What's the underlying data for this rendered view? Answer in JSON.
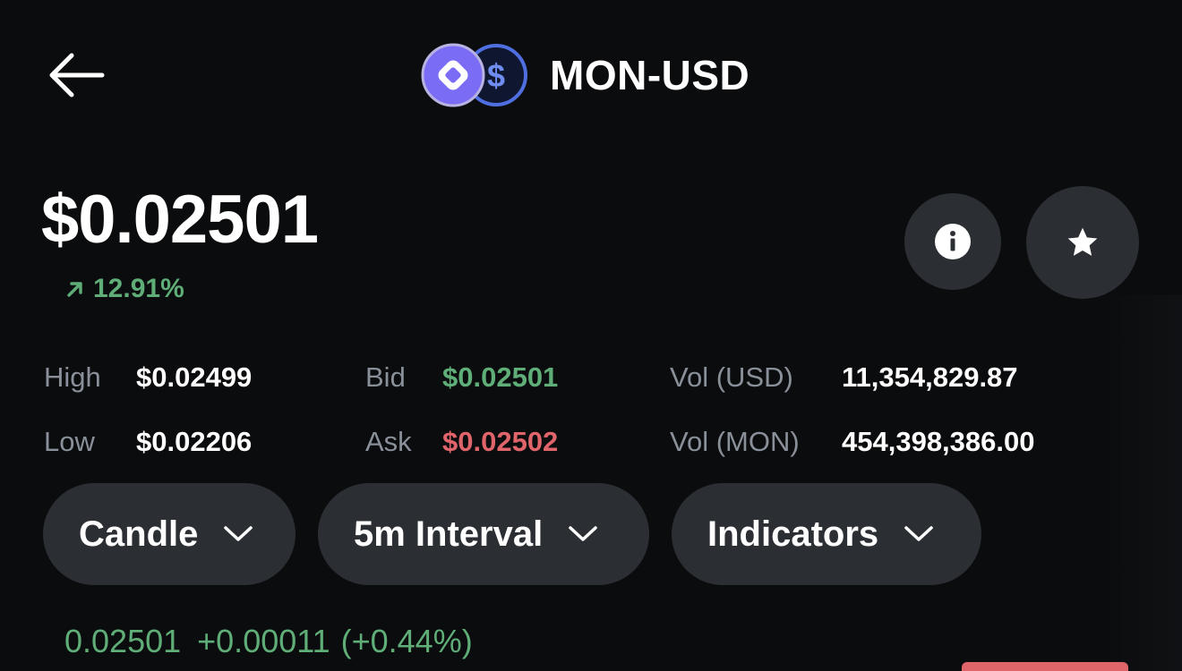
{
  "header": {
    "back_icon": "arrow-left-icon",
    "base_coin_icon": "mon-coin-icon",
    "quote_coin_icon": "usd-coin-icon",
    "pair": "MON-USD"
  },
  "price": {
    "value": "$0.02501",
    "change_icon": "arrow-up-right-icon",
    "change": "12.91%"
  },
  "actions": {
    "info_icon": "info-icon",
    "star_icon": "star-icon"
  },
  "stats": {
    "high": {
      "label": "High",
      "value": "$0.02499"
    },
    "low": {
      "label": "Low",
      "value": "$0.02206"
    },
    "bid": {
      "label": "Bid",
      "value": "$0.02501"
    },
    "ask": {
      "label": "Ask",
      "value": "$0.02502"
    },
    "vol_usd": {
      "label": "Vol (USD)",
      "value": "11,354,829.87"
    },
    "vol_mon": {
      "label": "Vol (MON)",
      "value": "454,398,386.00"
    }
  },
  "controls": {
    "chart_type": "Candle",
    "interval": "5m Interval",
    "indicators": "Indicators"
  },
  "readout": {
    "price": "0.02501",
    "delta": "+0.00011",
    "delta_pct": "(+0.44%)"
  },
  "colors": {
    "background": "#0b0c0e",
    "surface": "#2b2e33",
    "positive": "#5fae78",
    "negative": "#e0656b",
    "muted": "#8a9099",
    "mon_brand": "#7b6cf6",
    "usd_brand": "#4f6fe0"
  }
}
